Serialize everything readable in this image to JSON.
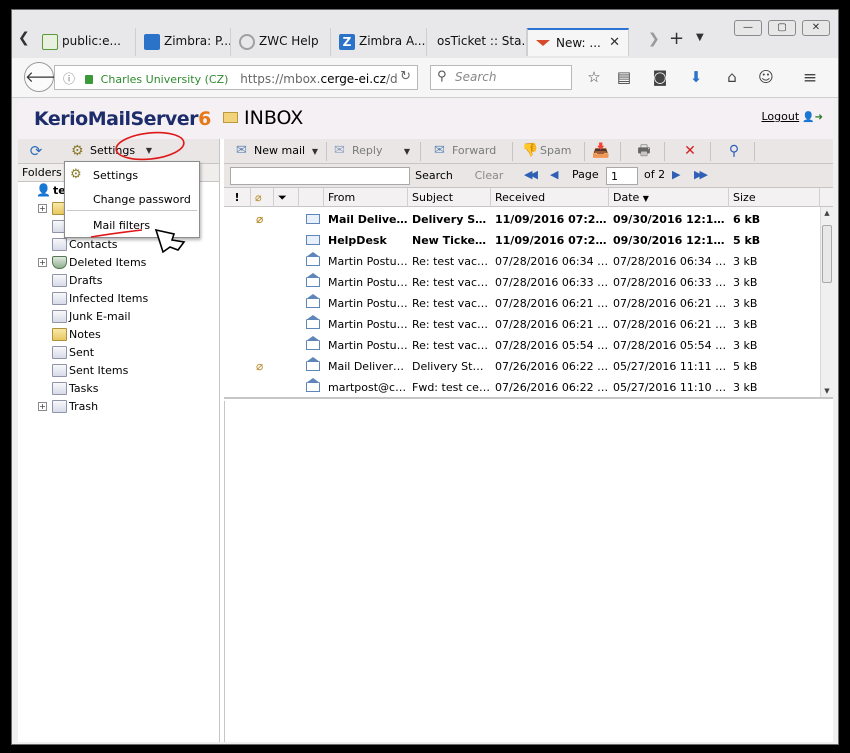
{
  "browser": {
    "tabs": [
      {
        "label": "public:e...",
        "color": "#5a9a3a"
      },
      {
        "label": "Zimbra: P...",
        "color": "#e2572b"
      },
      {
        "label": "ZWC Help",
        "color": "#a0a0a0"
      },
      {
        "label": "Zimbra A...",
        "color": "#2a73c8"
      },
      {
        "label": "osTicket :: Sta...",
        "color": ""
      },
      {
        "label": "New: ...",
        "color": "#d44a2a"
      }
    ],
    "window_controls": {
      "minimize": "—",
      "maximize": "▢",
      "close": "✕"
    },
    "nav": {
      "org": "Charles University (CZ)",
      "url_prefix": "https://mbox.",
      "url_host": "cerge-ei.cz",
      "url_suffix": "/d",
      "search_placeholder": "Search"
    }
  },
  "app": {
    "logo_text": "KerioMailServer",
    "logo_number": "6",
    "title": "INBOX",
    "logout": "Logout",
    "accent": "#e67817"
  },
  "left": {
    "settings_label": "Settings",
    "folders_header": "Folders",
    "account_label": "te",
    "folders": [
      {
        "label": "Contacts"
      },
      {
        "label": "Deleted Items"
      },
      {
        "label": "Drafts"
      },
      {
        "label": "Infected Items"
      },
      {
        "label": "Junk E-mail"
      },
      {
        "label": "Notes"
      },
      {
        "label": "Sent"
      },
      {
        "label": "Sent Items"
      },
      {
        "label": "Tasks"
      },
      {
        "label": "Trash"
      }
    ],
    "menu": {
      "items": [
        "Settings",
        "Change password",
        "Mail filters"
      ]
    }
  },
  "toolbar": {
    "new_mail": "New mail",
    "reply": "Reply",
    "forward": "Forward",
    "spam": "Spam"
  },
  "searchrow": {
    "search": "Search",
    "clear": "Clear",
    "page_label": "Page",
    "page_value": "1",
    "of_pages": "of 2"
  },
  "grid": {
    "columns": {
      "from": "From",
      "subject": "Subject",
      "received": "Received",
      "date": "Date",
      "size": "Size"
    },
    "rows": [
      {
        "from": "Mail Deliver...",
        "subject": "Delivery St...",
        "received": "11/09/2016 07:27...",
        "date": "09/30/2016 12:16...",
        "size": "6 kB",
        "unread": true,
        "attach": true
      },
      {
        "from": "HelpDesk",
        "subject": "New Ticket ...",
        "received": "11/09/2016 07:27...",
        "date": "09/30/2016 12:12...",
        "size": "5 kB",
        "unread": true,
        "attach": false
      },
      {
        "from": "Martin Postulka",
        "subject": "Re: test vaca...",
        "received": "07/28/2016 06:34 PM",
        "date": "07/28/2016 06:34 PM",
        "size": "3 kB",
        "unread": false,
        "attach": false
      },
      {
        "from": "Martin Postulka",
        "subject": "Re: test vaca...",
        "received": "07/28/2016 06:33 PM",
        "date": "07/28/2016 06:33 PM",
        "size": "3 kB",
        "unread": false,
        "attach": false
      },
      {
        "from": "Martin Postulka",
        "subject": "Re: test vaca...",
        "received": "07/28/2016 06:21 PM",
        "date": "07/28/2016 06:21 PM",
        "size": "3 kB",
        "unread": false,
        "attach": false
      },
      {
        "from": "Martin Postulka",
        "subject": "Re: test vaca...",
        "received": "07/28/2016 06:21 PM",
        "date": "07/28/2016 06:21 PM",
        "size": "3 kB",
        "unread": false,
        "attach": false
      },
      {
        "from": "Martin Postulka",
        "subject": "Re: test vaca...",
        "received": "07/28/2016 05:54 PM",
        "date": "07/28/2016 05:54 PM",
        "size": "3 kB",
        "unread": false,
        "attach": false
      },
      {
        "from": "Mail Delivery ...",
        "subject": "Delivery Statu...",
        "received": "07/26/2016 06:22 PM",
        "date": "05/27/2016 11:11 AM",
        "size": "5 kB",
        "unread": false,
        "attach": true
      },
      {
        "from": "martpost@ce...",
        "subject": "Fwd: test cen...",
        "received": "07/26/2016 06:22 PM",
        "date": "05/27/2016 11:10 AM",
        "size": "3 kB",
        "unread": false,
        "attach": false
      }
    ]
  }
}
